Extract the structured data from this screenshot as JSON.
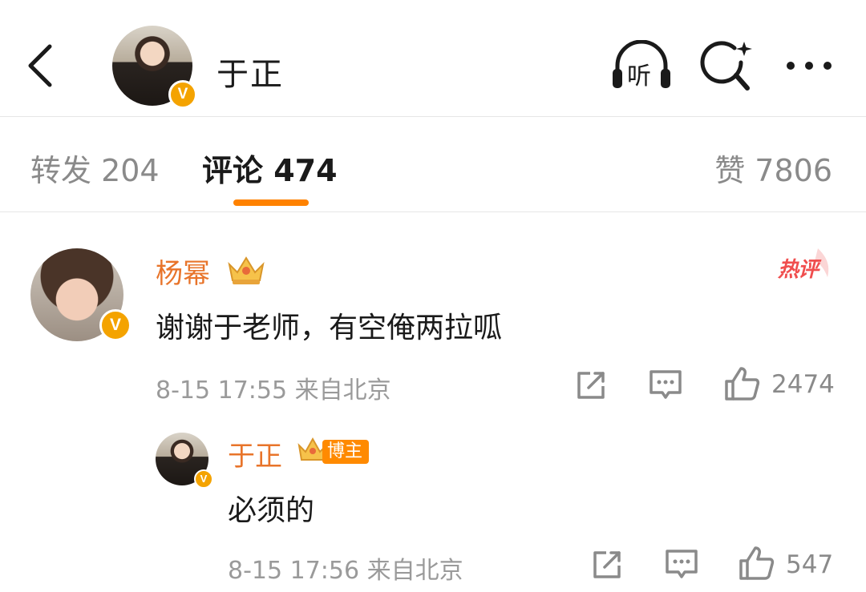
{
  "header": {
    "title": "于正",
    "verified_mark": "V",
    "listen_label": "听",
    "icons": [
      "back-icon",
      "listen-icon",
      "search-icon",
      "more-icon"
    ]
  },
  "tabs": [
    {
      "label": "转发 204",
      "active": false
    },
    {
      "label": "评论 474",
      "active": true
    },
    {
      "label": "赞 7806",
      "active": false
    }
  ],
  "colors": {
    "accent": "#ff8200",
    "username": "#e8742a",
    "verified": "#f4a300",
    "hot": "#f04e4e",
    "meta": "#9a9a9a"
  },
  "comments": [
    {
      "username": "杨幂",
      "verified_mark": "V",
      "badge": "crown-icon",
      "hot_tag": "热评",
      "text": "谢谢于老师，有空俺两拉呱",
      "meta": "8-15 17:55 来自北京",
      "likes": "2474",
      "reply": {
        "username": "于正",
        "verified_mark": "V",
        "badge_label": "博主",
        "text": "必须的",
        "meta": "8-15 17:56 来自北京",
        "likes": "547"
      }
    }
  ]
}
